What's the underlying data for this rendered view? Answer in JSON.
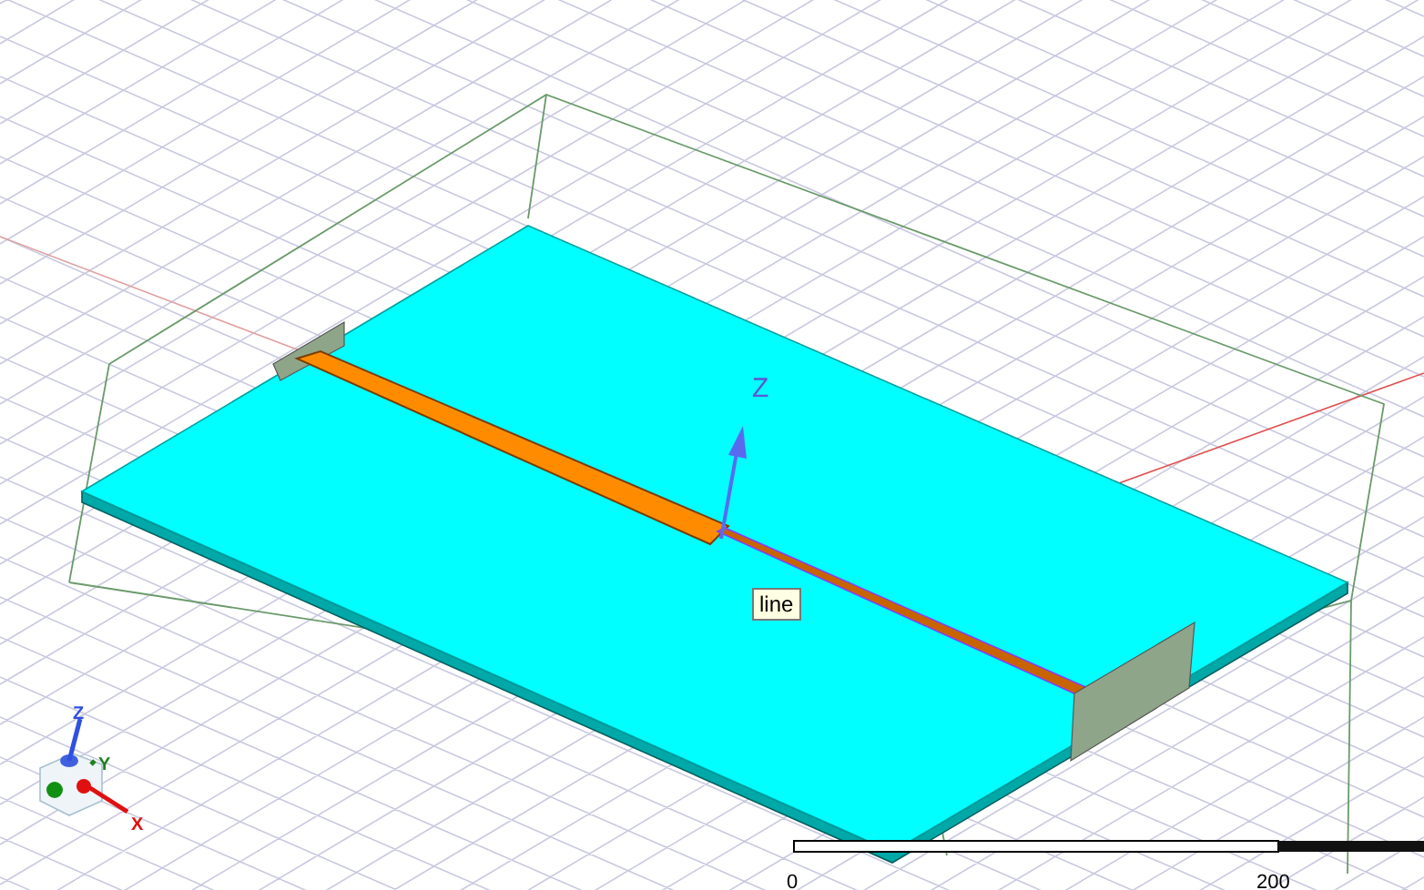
{
  "viewport": {
    "axis_label": "Z",
    "tooltip": "line"
  },
  "triad": [
    {
      "kind": "z",
      "label": "Z"
    },
    {
      "kind": "y",
      "label": "Y"
    },
    {
      "kind": "x",
      "label": "X"
    }
  ],
  "scale_bar": {
    "labels": [
      "0",
      "200"
    ]
  }
}
